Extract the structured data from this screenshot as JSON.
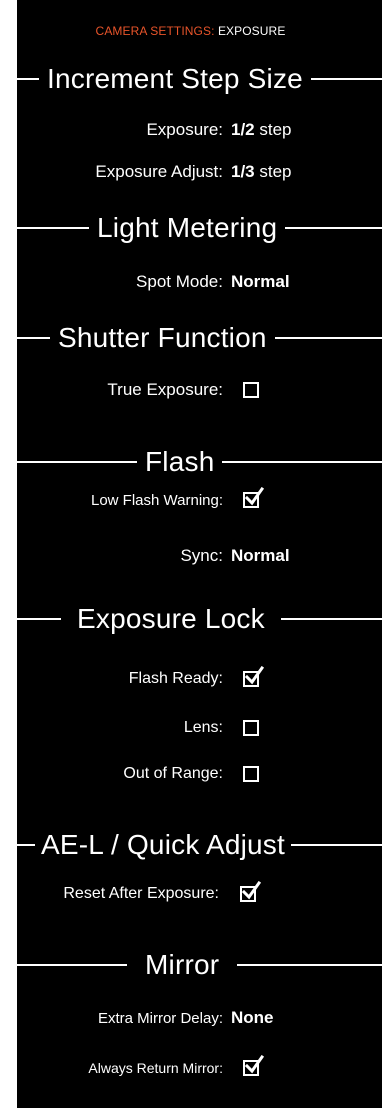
{
  "breadcrumb": {
    "parent": "CAMERA SETTINGS:",
    "current": "EXPOSURE"
  },
  "colors": {
    "accent": "#e8542a",
    "background": "#000000",
    "text": "#ffffff"
  },
  "sections": {
    "increment": {
      "title": "Increment Step Size",
      "exposure_label": "Exposure:",
      "exposure_value": "1/2",
      "exposure_unit": "step",
      "adjust_label": "Exposure Adjust:",
      "adjust_value": "1/3",
      "adjust_unit": "step"
    },
    "metering": {
      "title": "Light Metering",
      "spot_label": "Spot Mode:",
      "spot_value": "Normal"
    },
    "shutter": {
      "title": "Shutter Function",
      "true_exposure_label": "True Exposure:",
      "true_exposure_checked": false
    },
    "flash": {
      "title": "Flash",
      "low_flash_label": "Low Flash Warning:",
      "low_flash_checked": true,
      "sync_label": "Sync:",
      "sync_value": "Normal"
    },
    "exposure_lock": {
      "title": "Exposure Lock",
      "flash_ready_label": "Flash Ready:",
      "flash_ready_checked": true,
      "lens_label": "Lens:",
      "lens_checked": false,
      "out_of_range_label": "Out of Range:",
      "out_of_range_checked": false
    },
    "ael": {
      "title": "AE-L / Quick Adjust",
      "reset_label": "Reset After Exposure:",
      "reset_checked": true
    },
    "mirror": {
      "title": "Mirror",
      "delay_label": "Extra Mirror Delay:",
      "delay_value": "None",
      "return_label": "Always Return Mirror:",
      "return_checked": true
    }
  }
}
